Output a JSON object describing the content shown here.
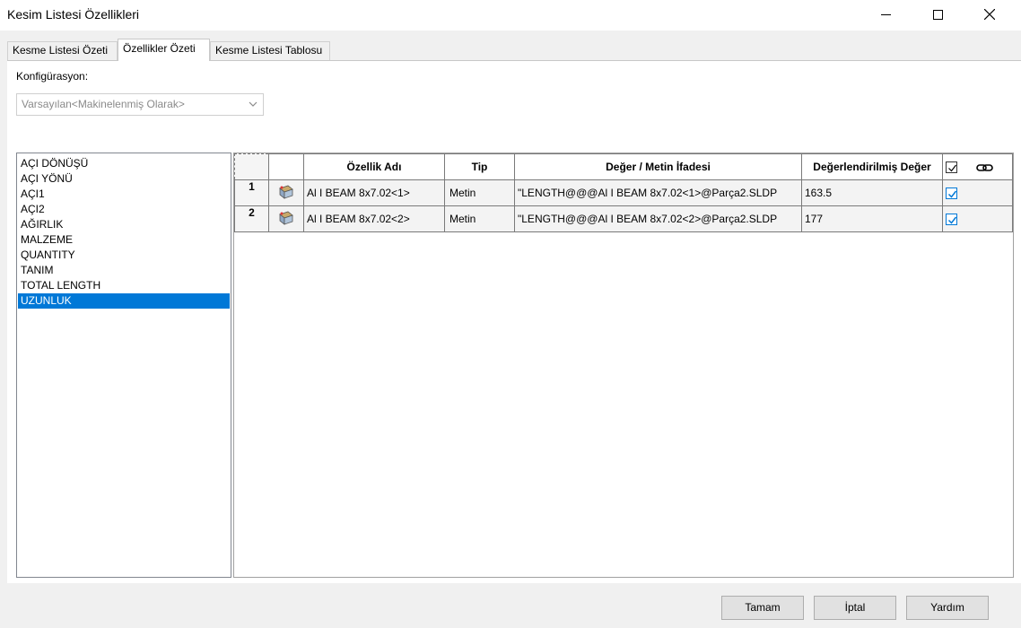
{
  "window": {
    "title": "Kesim Listesi Özellikleri"
  },
  "tabs": [
    {
      "label": "Kesme Listesi Özeti",
      "active": false
    },
    {
      "label": "Özellikler Özeti",
      "active": true
    },
    {
      "label": "Kesme Listesi Tablosu",
      "active": false
    }
  ],
  "config": {
    "label": "Konfigürasyon:",
    "selected": "Varsayılan<Makinelenmiş Olarak>"
  },
  "properties_list": {
    "items": [
      "AÇI DÖNÜŞÜ",
      "AÇI YÖNÜ",
      "AÇI1",
      "AÇI2",
      "AĞIRLIK",
      "MALZEME",
      "QUANTITY",
      "TANIM",
      "TOTAL LENGTH",
      "UZUNLUK"
    ],
    "selected_index": 9
  },
  "table": {
    "headers": {
      "property_name": "Özellik Adı",
      "type": "Tip",
      "value_expression": "Değer / Metin İfadesi",
      "evaluated_value": "Değerlendirilmiş Değer"
    },
    "rows": [
      {
        "num": "1",
        "name": "Al I BEAM 8x7.02<1>",
        "type": "Metin",
        "expression": "\"LENGTH@@@Al I BEAM 8x7.02<1>@Parça2.SLDP",
        "evaluated": "163.5",
        "checked": true
      },
      {
        "num": "2",
        "name": "Al I BEAM 8x7.02<2>",
        "type": "Metin",
        "expression": "\"LENGTH@@@Al I BEAM 8x7.02<2>@Parça2.SLDP",
        "evaluated": "177",
        "checked": true
      }
    ]
  },
  "buttons": {
    "ok": "Tamam",
    "cancel": "İptal",
    "help": "Yardım"
  },
  "colors": {
    "selection": "#0078d7",
    "checkbox": "#0078d7"
  }
}
